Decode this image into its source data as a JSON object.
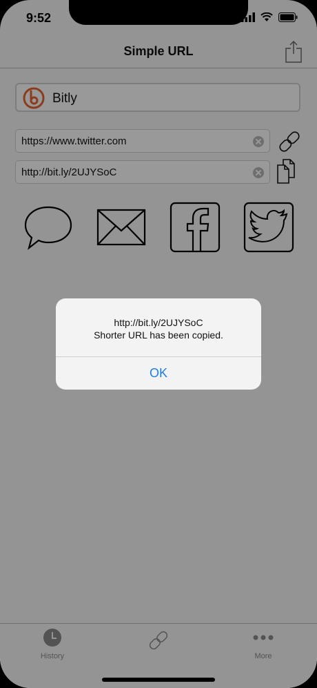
{
  "status_bar": {
    "time": "9:52"
  },
  "navbar": {
    "title": "Simple URL",
    "share_icon": "share-icon"
  },
  "service": {
    "name": "Bitly",
    "logo": "bitly-logo",
    "logo_color": "#e8652c"
  },
  "long_url": {
    "value": "https://www.twitter.com"
  },
  "short_url": {
    "value": "http://bit.ly/2UJYSoC"
  },
  "share_targets": [
    "message-icon",
    "mail-icon",
    "facebook-icon",
    "twitter-icon"
  ],
  "tabbar": {
    "tabs": [
      {
        "label": "History",
        "icon": "clock-icon"
      },
      {
        "label": "",
        "icon": "link-icon"
      },
      {
        "label": "More",
        "icon": "more-icon"
      }
    ]
  },
  "alert": {
    "line1": "http://bit.ly/2UJYSoC",
    "line2": "Shorter URL has been copied.",
    "ok_label": "OK",
    "accent": "#1a7ee3"
  }
}
